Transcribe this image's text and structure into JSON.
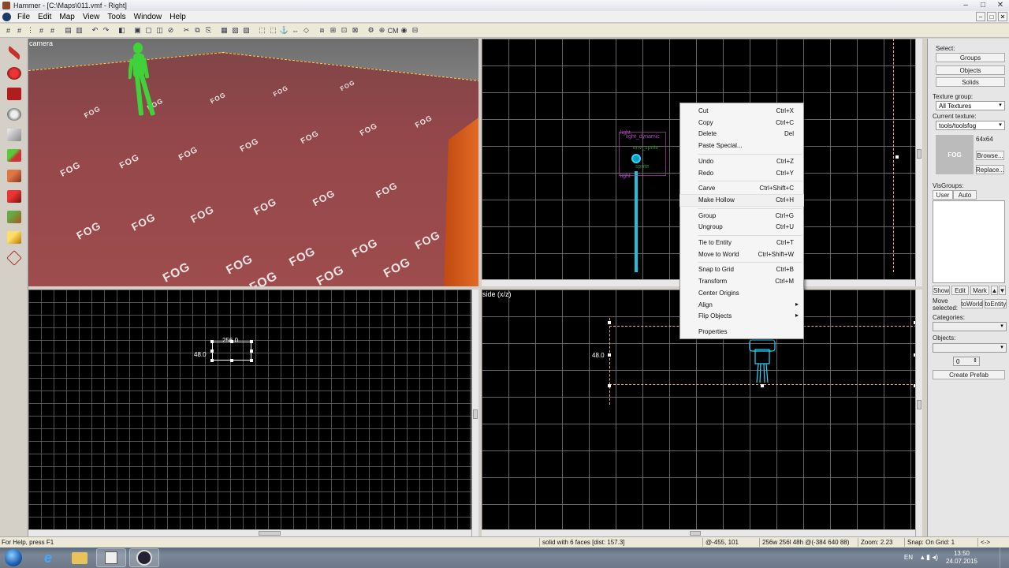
{
  "window": {
    "title": "Hammer - [C:\\Maps\\011.vmf - Right]",
    "controls": [
      "–",
      "□",
      "✕"
    ]
  },
  "menu": {
    "items": [
      "File",
      "Edit",
      "Map",
      "View",
      "Tools",
      "Window",
      "Help"
    ],
    "mdi_controls": [
      "–",
      "□",
      "✕"
    ]
  },
  "views": {
    "camera_label": "camera",
    "side_label": "side (x/z)",
    "top_left_dim_w": "256.0",
    "top_left_dim_h": "48.0",
    "side_dim_h": "48.0",
    "floor_texture_text": "FOG"
  },
  "entity_labels": {
    "light": "light",
    "light_dynamic": "light_dynamic",
    "env_sprite": "env_sprite",
    "sprite": "sprite"
  },
  "context_menu": {
    "items": [
      {
        "label": "Cut",
        "shortcut": "Ctrl+X"
      },
      {
        "label": "Copy",
        "shortcut": "Ctrl+C"
      },
      {
        "label": "Delete",
        "shortcut": "Del"
      },
      {
        "label": "Paste Special...",
        "shortcut": ""
      },
      {
        "label": "Undo",
        "shortcut": "Ctrl+Z"
      },
      {
        "label": "Redo",
        "shortcut": "Ctrl+Y"
      },
      {
        "label": "Carve",
        "shortcut": "Ctrl+Shift+C"
      },
      {
        "label": "Make Hollow",
        "shortcut": "Ctrl+H",
        "highlighted": true
      },
      {
        "label": "Group",
        "shortcut": "Ctrl+G"
      },
      {
        "label": "Ungroup",
        "shortcut": "Ctrl+U"
      },
      {
        "label": "Tie to Entity",
        "shortcut": "Ctrl+T"
      },
      {
        "label": "Move to World",
        "shortcut": "Ctrl+Shift+W"
      },
      {
        "label": "Snap to Grid",
        "shortcut": "Ctrl+B"
      },
      {
        "label": "Transform",
        "shortcut": "Ctrl+M"
      },
      {
        "label": "Center Origins",
        "shortcut": ""
      },
      {
        "label": "Align",
        "shortcut": "",
        "submenu": true
      },
      {
        "label": "Flip Objects",
        "shortcut": "",
        "submenu": true
      },
      {
        "label": "Properties",
        "shortcut": ""
      }
    ]
  },
  "right_panel": {
    "select_label": "Select:",
    "select_buttons": [
      "Groups",
      "Objects",
      "Solids"
    ],
    "texture_group_label": "Texture group:",
    "texture_group_value": "All Textures",
    "current_texture_label": "Current texture:",
    "current_texture_value": "tools/toolsfog",
    "texture_size": "64x64",
    "texture_preview_text": "FOG",
    "browse_button": "Browse...",
    "replace_button": "Replace...",
    "visgroups_label": "VisGroups:",
    "visgroup_tabs": [
      "User",
      "Auto"
    ],
    "vis_buttons": [
      "Show",
      "Edit",
      "Mark"
    ],
    "move_selected_label": "Move selected:",
    "to_world_button": "toWorld",
    "to_entity_button": "toEntity",
    "categories_label": "Categories:",
    "objects_label": "Objects:",
    "stepper_value": "0",
    "create_prefab_button": "Create Prefab"
  },
  "status": {
    "help": "For Help, press F1",
    "selection": "solid with 6 faces  [dist: 157.3]",
    "coords": "@-455, 101",
    "size": "256w 256l 48h @(-384 640 88)",
    "zoom": "Zoom: 2.23",
    "snap": "Snap: On Grid: 1",
    "arrows": "<->"
  },
  "taskbar": {
    "apps": [
      "windows-start",
      "internet-explorer",
      "file-explorer",
      "media-player",
      "hammer-editor"
    ],
    "language": "EN",
    "time": "13:50",
    "date": "24.07.2015"
  }
}
